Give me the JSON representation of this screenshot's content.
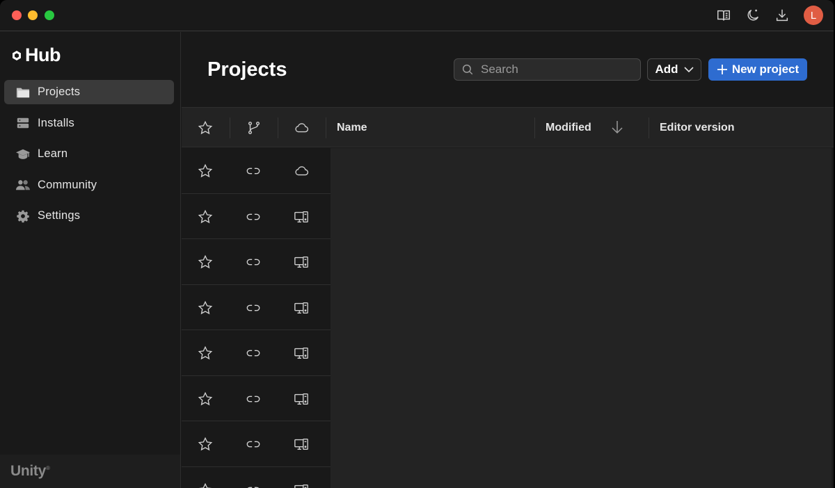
{
  "app": {
    "logo_text": "Hub",
    "footer_logo": "Unity",
    "footer_logo_mark": "®"
  },
  "titlebar": {
    "icons": [
      "book-icon",
      "moon-icon",
      "download-icon"
    ],
    "avatar_initial": "L",
    "avatar_color": "#e05d44"
  },
  "sidebar": {
    "items": [
      {
        "label": "Projects",
        "icon": "folder-icon",
        "active": true
      },
      {
        "label": "Installs",
        "icon": "server-icon",
        "active": false
      },
      {
        "label": "Learn",
        "icon": "graduation-cap-icon",
        "active": false
      },
      {
        "label": "Community",
        "icon": "people-icon",
        "active": false
      },
      {
        "label": "Settings",
        "icon": "gear-icon",
        "active": false
      }
    ]
  },
  "main": {
    "title": "Projects",
    "search_placeholder": "Search",
    "add_label": "Add",
    "new_project_label": "New project",
    "accent_color": "#2e6cd0"
  },
  "table": {
    "columns": {
      "name": "Name",
      "modified": "Modified",
      "editor_version": "Editor version"
    },
    "rows": [
      {
        "location": "cloud-icon"
      },
      {
        "location": "computer-icon"
      },
      {
        "location": "computer-icon"
      },
      {
        "location": "computer-icon"
      },
      {
        "location": "computer-icon"
      },
      {
        "location": "computer-icon"
      },
      {
        "location": "computer-icon"
      },
      {
        "location": "computer-icon"
      }
    ]
  }
}
